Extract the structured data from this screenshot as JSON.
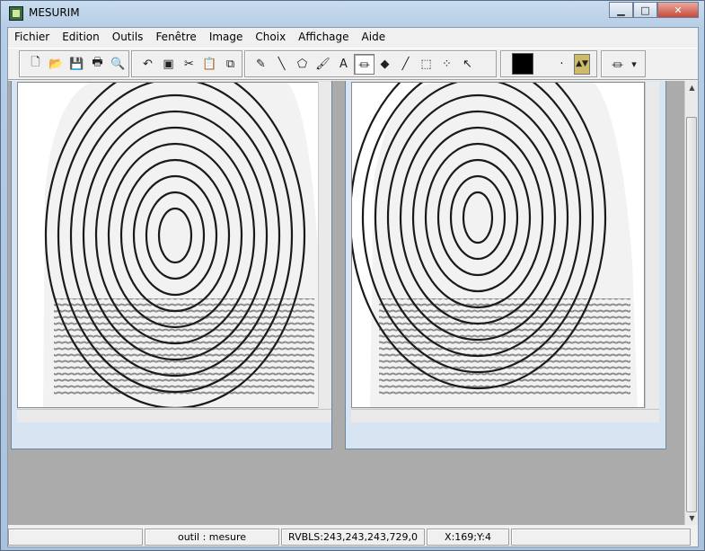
{
  "window": {
    "title": "MESURIM",
    "minimize": "▁",
    "maximize": "□",
    "close": "✕"
  },
  "menu": [
    "Fichier",
    "Edition",
    "Outils",
    "Fenêtre",
    "Image",
    "Choix",
    "Affichage",
    "Aide"
  ],
  "toolbar": {
    "file_tools": [
      {
        "name": "new-icon",
        "glyph": "🗋"
      },
      {
        "name": "open-icon",
        "glyph": "📂"
      },
      {
        "name": "save-icon",
        "glyph": "💾"
      },
      {
        "name": "print-icon",
        "glyph": "🖶"
      },
      {
        "name": "zoom-icon",
        "glyph": "🔍"
      }
    ],
    "edit_tools": [
      {
        "name": "undo-icon",
        "glyph": "↶"
      },
      {
        "name": "image-icon",
        "glyph": "▣"
      },
      {
        "name": "cut-icon",
        "glyph": "✂"
      },
      {
        "name": "paste-icon",
        "glyph": "📋"
      },
      {
        "name": "copy-icon",
        "glyph": "⧉"
      }
    ],
    "draw_tools": [
      {
        "name": "pencil-icon",
        "glyph": "✎"
      },
      {
        "name": "line-icon",
        "glyph": "╲"
      },
      {
        "name": "shape-icon",
        "glyph": "⬠"
      },
      {
        "name": "brush-icon",
        "glyph": "🖌"
      },
      {
        "name": "text-icon",
        "glyph": "A"
      },
      {
        "name": "measure-icon",
        "glyph": "⏛"
      },
      {
        "name": "fill-icon",
        "glyph": "◆"
      },
      {
        "name": "color-picker-icon",
        "glyph": "╱"
      },
      {
        "name": "select-rect-icon",
        "glyph": "⬚"
      },
      {
        "name": "points-icon",
        "glyph": "⁘"
      },
      {
        "name": "pointer-icon",
        "glyph": "↖"
      }
    ],
    "color": "#000000",
    "size_dot": "·",
    "stepper": "▲▼",
    "mode_glyph": "⏛",
    "mode_arrow": "▾"
  },
  "images": [
    "fingerprint-left",
    "fingerprint-right"
  ],
  "status": {
    "panel1": "",
    "tool": "outil : mesure",
    "rvbls": "RVBLS:243,243,243,729,0",
    "coords": "X:169;Y:4"
  }
}
